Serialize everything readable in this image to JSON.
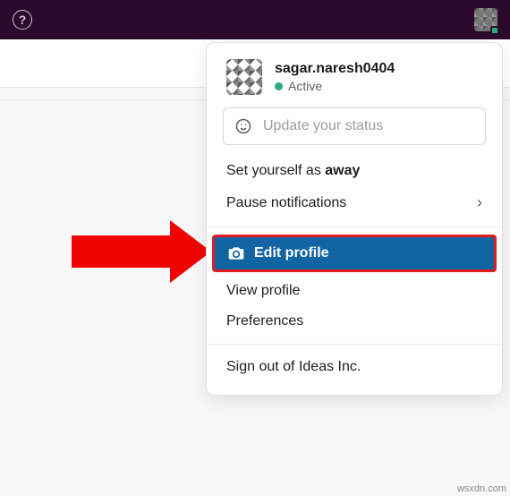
{
  "topbar": {
    "help_title": "?"
  },
  "user": {
    "name": "sagar.naresh0404",
    "presence_label": "Active"
  },
  "status": {
    "placeholder": "Update your status"
  },
  "menu": {
    "set_away_prefix": "Set yourself as ",
    "set_away_bold": "away",
    "pause": "Pause notifications",
    "edit_profile": "Edit profile",
    "view_profile": "View profile",
    "preferences": "Preferences",
    "sign_out": "Sign out of Ideas Inc."
  },
  "watermark": "wsxdn.com"
}
